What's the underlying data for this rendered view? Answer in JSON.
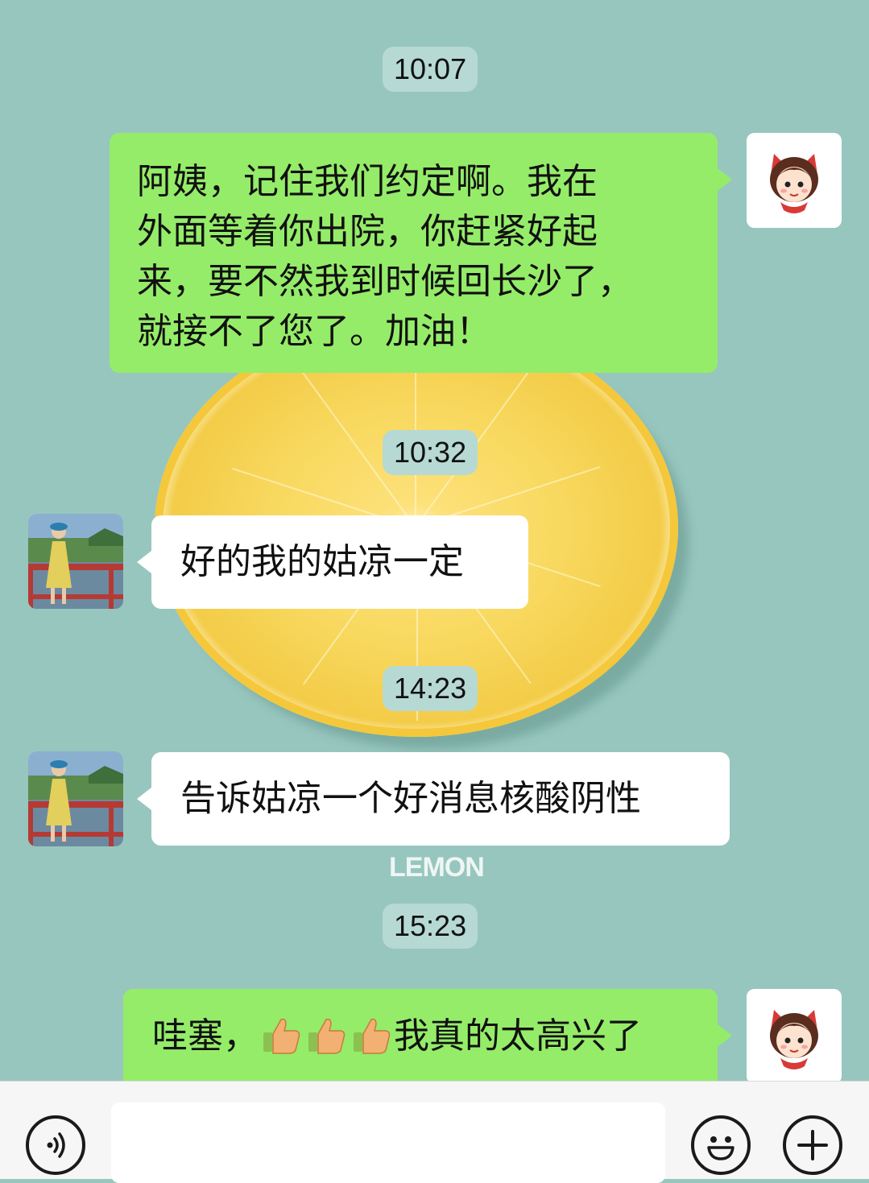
{
  "conversation": {
    "messages": [
      {
        "type": "time",
        "text": "10:07"
      },
      {
        "type": "outgoing",
        "sender": "self",
        "text": "阿姨，记住我们约定啊。我在外面等着你出院，你赶紧好起来，要不然我到时候回长沙了，就接不了您了。加油！",
        "lines": [
          "阿姨，记住我们约定啊。我在",
          "外面等着你出院，你赶紧好起",
          "来，要不然我到时候回长沙了，",
          "就接不了您了。加油！"
        ]
      },
      {
        "type": "time",
        "text": "10:32"
      },
      {
        "type": "incoming",
        "sender": "aunt",
        "text": "好的我的姑凉一定"
      },
      {
        "type": "time",
        "text": "14:23"
      },
      {
        "type": "incoming",
        "sender": "aunt",
        "text": "告诉姑凉一个好消息核酸阴性"
      },
      {
        "type": "time",
        "text": "15:23"
      },
      {
        "type": "outgoing",
        "sender": "self",
        "text_before": "哇塞，",
        "emoji": [
          "thumbs-up",
          "thumbs-up",
          "thumbs-up"
        ],
        "text_after": "我真的太高兴了"
      }
    ]
  },
  "wallpaper": {
    "word": "LEMON"
  },
  "colors": {
    "background": "#97c6be",
    "outgoing_bubble": "#95ec69",
    "incoming_bubble": "#ffffff",
    "time_pill": "#b7d9d3",
    "input_bar": "#f6f6f6"
  },
  "input_bar": {
    "left_icon": "voice-icon",
    "right_icons": [
      "emoji-icon",
      "plus-icon"
    ]
  }
}
